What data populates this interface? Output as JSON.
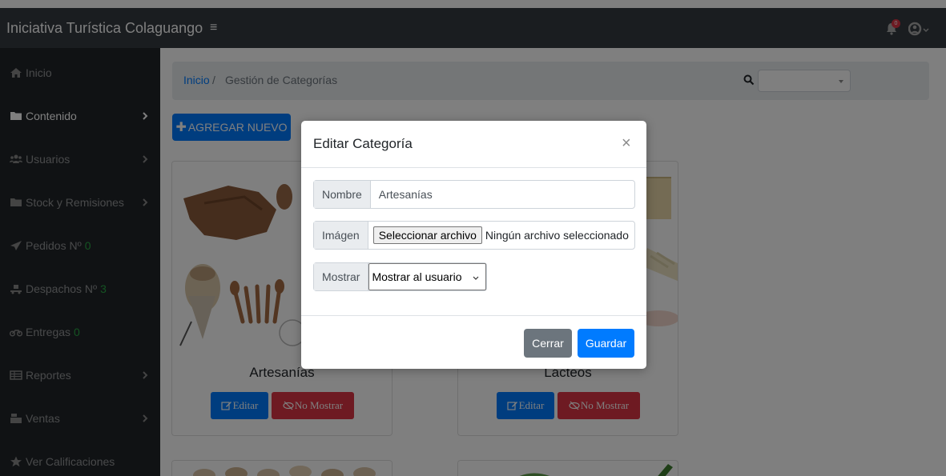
{
  "navbar": {
    "brand": "Iniciativa Turística Colaguango",
    "toggle_icon": "menu-icon",
    "bell_badge": "0",
    "icons": [
      "bell-icon",
      "user-icon"
    ]
  },
  "sidebar": {
    "items": [
      {
        "label": "Inicio",
        "icon": "home-icon"
      },
      {
        "label": "Contenido",
        "icon": "folder-icon",
        "chevron": true
      },
      {
        "label": "Usuarios",
        "icon": "users-icon",
        "chevron": true
      },
      {
        "label": "Stock y Remisiones",
        "icon": "folder-icon",
        "chevron": true
      },
      {
        "label": "Pedidos Nº",
        "count": "0",
        "icon": "paper-plane-icon"
      },
      {
        "label": "Despachos Nº",
        "count": "3",
        "icon": "dolly-icon"
      },
      {
        "label": "Entregas",
        "count": "0",
        "icon": "motorcycle-icon"
      },
      {
        "label": "Reportes",
        "icon": "table-icon",
        "chevron": true
      },
      {
        "label": "Ventas",
        "icon": "cash-register-icon",
        "chevron": true
      },
      {
        "label": "Ver Calificaciones",
        "icon": "star-icon"
      }
    ]
  },
  "breadcrumb": {
    "home": "Inicio",
    "separator": "/",
    "current": "Gestión de Categorías"
  },
  "search": {
    "selected": ""
  },
  "add_button": {
    "label": "AGREGAR NUEVO"
  },
  "cards": [
    {
      "title": "Artesanías",
      "edit_label": "Editar",
      "hide_label": "No Mostrar"
    },
    {
      "title": "Lácteos",
      "edit_label": "Editar",
      "hide_label": "No Mostrar"
    }
  ],
  "modal": {
    "title": "Editar Categoría",
    "close_glyph": "×",
    "fields": {
      "nombre_label": "Nombre",
      "nombre_value": "Artesanías",
      "imagen_label": "Imágen",
      "file_button": "Seleccionar archivo",
      "file_status": "Ningún archivo seleccionado",
      "mostrar_label": "Mostrar",
      "mostrar_value": "Mostrar al usuario"
    },
    "footer": {
      "close_label": "Cerrar",
      "save_label": "Guardar"
    }
  },
  "colors": {
    "navbar": "#343a40",
    "sidebar": "#212529",
    "primary": "#007bff",
    "danger": "#dc3545",
    "secondary": "#6c757d",
    "success": "#28a745"
  }
}
